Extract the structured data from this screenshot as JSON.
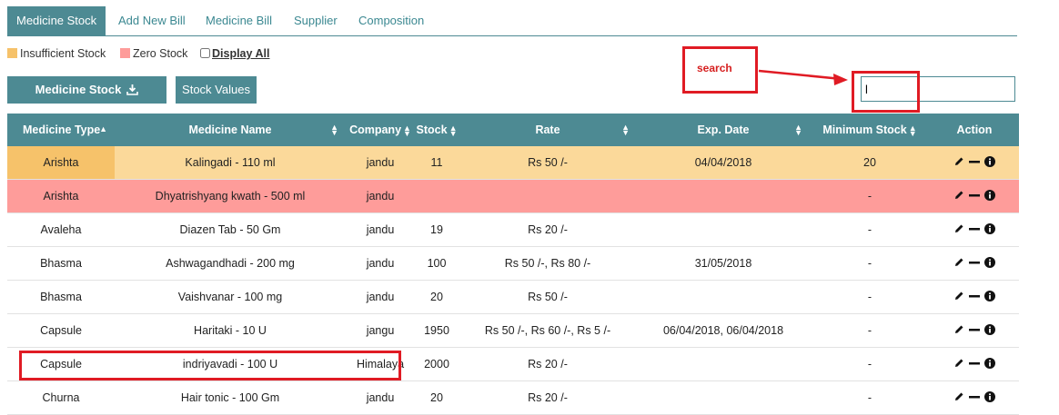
{
  "tabs": [
    {
      "label": "Medicine Stock"
    },
    {
      "label": "Add New Bill"
    },
    {
      "label": "Medicine Bill"
    },
    {
      "label": "Supplier"
    },
    {
      "label": "Composition"
    }
  ],
  "legend": {
    "insufficient": "Insufficient Stock",
    "zero": "Zero Stock",
    "display_all": "Display All"
  },
  "toolbar": {
    "medicine_stock_btn": "Medicine Stock",
    "stock_values_btn": "Stock Values"
  },
  "search": {
    "value": "l",
    "annotation": "search"
  },
  "colors": {
    "header": "#4d8a93",
    "insufficient": "#f6c26a",
    "zero": "#fe9c9a",
    "annotation": "#e01b24"
  },
  "table": {
    "headers": [
      "Medicine Type",
      "Medicine Name",
      "Company",
      "Stock",
      "Rate",
      "Exp. Date",
      "Minimum Stock",
      "Action"
    ],
    "rows": [
      {
        "type": "Arishta",
        "name": "Kalingadi - 110 ml",
        "company": "jandu",
        "stock": "11",
        "rate": "Rs 50 /-",
        "exp": "04/04/2018",
        "min": "20",
        "status": "insufficient"
      },
      {
        "type": "Arishta",
        "name": "Dhyatrishyang kwath - 500 ml",
        "company": "jandu",
        "stock": "",
        "rate": "",
        "exp": "",
        "min": "-",
        "status": "zero"
      },
      {
        "type": "Avaleha",
        "name": "Diazen Tab - 50 Gm",
        "company": "jandu",
        "stock": "19",
        "rate": "Rs 20 /-",
        "exp": "",
        "min": "-",
        "status": ""
      },
      {
        "type": "Bhasma",
        "name": "Ashwagandhadi - 200 mg",
        "company": "jandu",
        "stock": "100",
        "rate": "Rs 50 /-, Rs 80 /-",
        "exp": "31/05/2018",
        "min": "-",
        "status": ""
      },
      {
        "type": "Bhasma",
        "name": "Vaishvanar - 100 mg",
        "company": "jandu",
        "stock": "20",
        "rate": "Rs 50 /-",
        "exp": "",
        "min": "-",
        "status": ""
      },
      {
        "type": "Capsule",
        "name": "Haritaki - 10 U",
        "company": "jangu",
        "stock": "1950",
        "rate": "Rs 50 /-, Rs 60 /-, Rs 5 /-",
        "exp": "06/04/2018, 06/04/2018",
        "min": "-",
        "status": ""
      },
      {
        "type": "Capsule",
        "name": "indriyavadi - 100 U",
        "company": "Himalaya",
        "stock": "2000",
        "rate": "Rs 20 /-",
        "exp": "",
        "min": "-",
        "status": ""
      },
      {
        "type": "Churna",
        "name": "Hair tonic - 100 Gm",
        "company": "jandu",
        "stock": "20",
        "rate": "Rs 20 /-",
        "exp": "",
        "min": "-",
        "status": ""
      }
    ]
  }
}
